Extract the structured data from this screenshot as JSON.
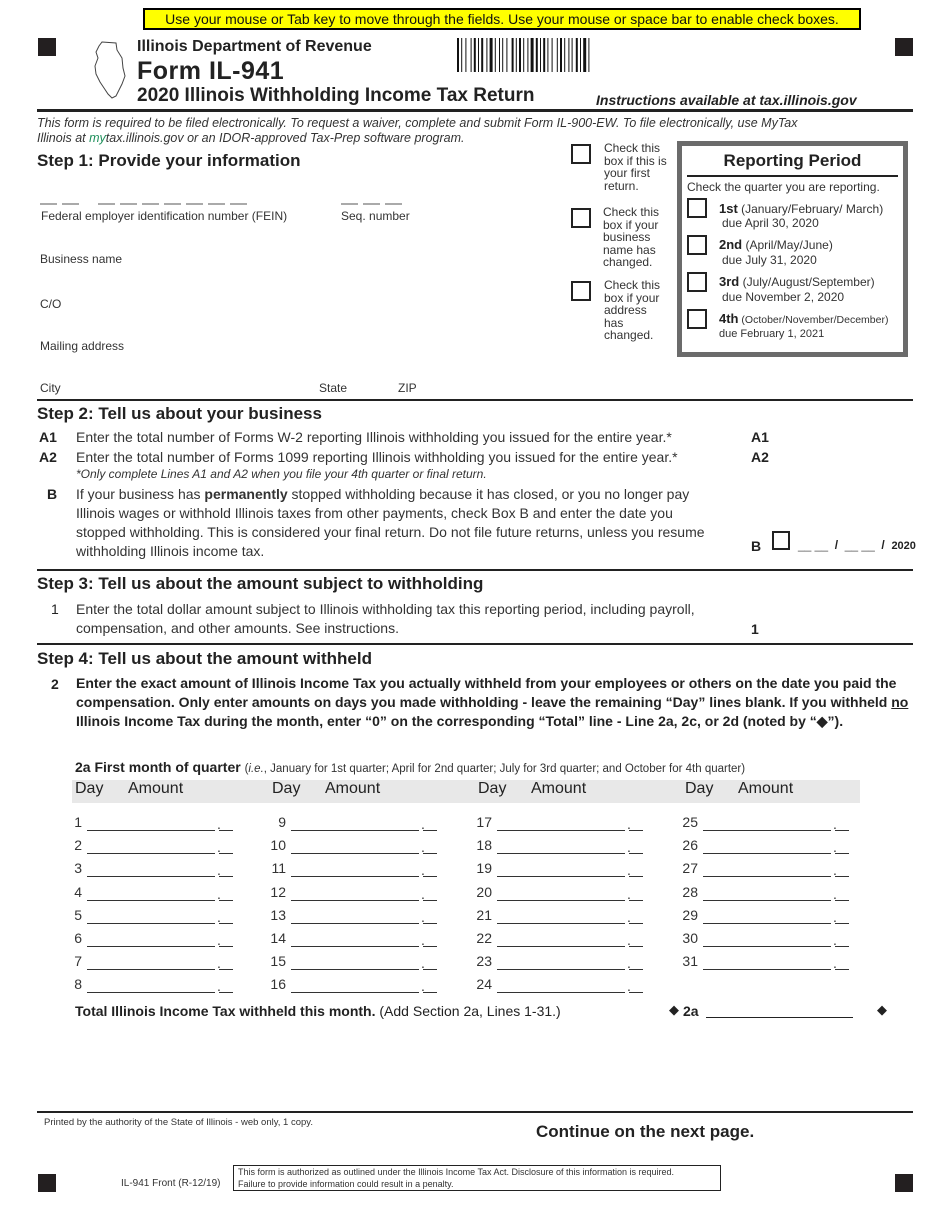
{
  "banner": "Use your mouse or Tab key to move through the fields. Use your mouse or space bar to enable check boxes.",
  "header": {
    "department": "Illinois Department of Revenue",
    "form_number": "Form IL-941",
    "form_title": "2020 Illinois Withholding Income Tax Return",
    "instructions": "Instructions available at tax.illinois.gov"
  },
  "intro": {
    "line1": "This form is required to be filed electronically. To request a waiver, complete and submit Form IL-900-EW.  To file electronically, use MyTax",
    "line2_pre": "Illinois at ",
    "line2_green": "my",
    "line2_post": "tax.illinois.gov or an IDOR-approved Tax-Prep software program."
  },
  "step1": {
    "heading": "Step 1:  Provide your information",
    "fein_label": "Federal employer identification number (FEIN)",
    "seq_label": "Seq. number",
    "business_name_label": "Business name",
    "co_label": "C/O",
    "mailing_label": "Mailing address",
    "city_label": "City",
    "state_label": "State",
    "zip_label": "ZIP",
    "fein_value": "",
    "seq_value": "",
    "business_name_value": "",
    "co_value": "",
    "mailing_value": "",
    "city_value": "",
    "state_value": "",
    "zip_value": ""
  },
  "checks": [
    {
      "text": "Check this box if this is your first return.",
      "checked": false
    },
    {
      "text": "Check this box if your business name has changed.",
      "checked": false
    },
    {
      "text": "Check this box if your address has changed.",
      "checked": false
    }
  ],
  "reporting_period": {
    "title": "Reporting Period",
    "subtitle": "Check the quarter you are reporting.",
    "quarters": [
      {
        "label": "1st",
        "months": "(January/February/ March)",
        "due": "due April 30, 2020",
        "checked": false
      },
      {
        "label": "2nd",
        "months": "(April/May/June)",
        "due": "due July 31, 2020",
        "checked": false
      },
      {
        "label": "3rd",
        "months": "(July/August/September)",
        "due": "due November 2, 2020",
        "checked": false
      },
      {
        "label": "4th",
        "months": "(October/November/December)",
        "due": "due February 1, 2021",
        "checked": false
      }
    ]
  },
  "step2": {
    "heading": "Step 2:  Tell us about your business",
    "a1_label": "A1",
    "a1_text": "Enter the total number of Forms W-2 reporting Illinois withholding you issued for the entire year.*",
    "a1_value": "",
    "a2_label": "A2",
    "a2_text": "Enter the total number of Forms 1099 reporting Illinois withholding you issued for the entire year.*",
    "a2_value": "",
    "note": "*Only complete Lines A1 and A2 when you file your 4th quarter or final return.",
    "b_label": "B",
    "b_text_pre": "If your business has ",
    "b_text_bold": "permanently",
    "b_text_post": " stopped withholding because it has closed, or you no longer pay Illinois wages or withhold Illinois taxes from other payments, check Box B and enter the date you stopped withholding. This is considered your final return. Do not file future returns, unless you resume withholding Illinois income tax.",
    "b_year": "2020",
    "b_checked": false
  },
  "step3": {
    "heading": "Step 3:  Tell us about the amount subject to withholding",
    "line_num": "1",
    "text": "Enter the total dollar amount subject to Illinois withholding tax this reporting period, including payroll, compensation, and other amounts. See instructions.",
    "value": ""
  },
  "step4": {
    "heading": "Step 4:  Tell us about the amount withheld",
    "line_num": "2",
    "text_pre": "Enter the exact amount of Illinois Income Tax you actually withheld from your employees or others on the date you paid the compensation.  Only enter amounts on days you made withholding - leave the remaining “Day” lines blank. If you withheld ",
    "text_underline": "no",
    "text_post": " Illinois Income Tax during the month, enter “0” on the corresponding “Total” line - Line 2a, 2c, or 2d (noted by “◆”).",
    "sub_label": "2a  First month of quarter",
    "sub_note_ie": "i.e.",
    "sub_note": ", January for 1st quarter; April for 2nd quarter; July for 3rd quarter; and October for 4th quarter)",
    "col_day": "Day",
    "col_amount": "Amount",
    "days": [
      "1",
      "2",
      "3",
      "4",
      "5",
      "6",
      "7",
      "8",
      "9",
      "10",
      "11",
      "12",
      "13",
      "14",
      "15",
      "16",
      "17",
      "18",
      "19",
      "20",
      "21",
      "22",
      "23",
      "24",
      "25",
      "26",
      "27",
      "28",
      "29",
      "30",
      "31"
    ],
    "total_bold": "Total Illinois Income Tax withheld this month.",
    "total_note": "(Add Section 2a, Lines 1-31.)",
    "total_label": "2a",
    "total_value": ""
  },
  "footer": {
    "printed": "Printed by the authority of the State of Illinois - web only, 1 copy.",
    "continue": "Continue on the next page.",
    "form_rev": "IL-941 Front (R-12/19)",
    "auth_line1": "This form is authorized as outlined under the Illinois Income Tax Act.  Disclosure of this information is required.",
    "auth_line2": "Failure to provide information could result in a penalty."
  }
}
